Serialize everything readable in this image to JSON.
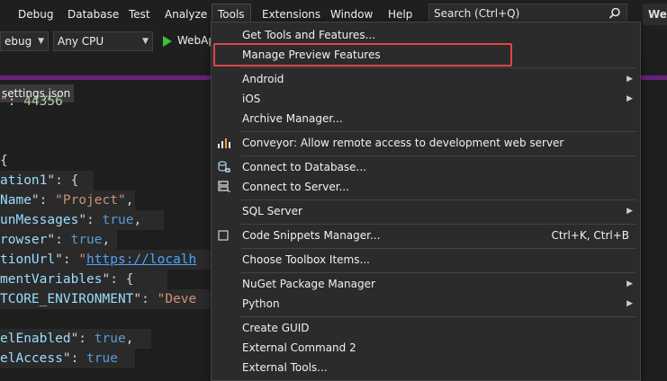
{
  "menubar": {
    "items": [
      "Debug",
      "Database",
      "Test",
      "Analyze",
      "Tools",
      "Extensions",
      "Window",
      "Help"
    ],
    "search_placeholder": "Search (Ctrl+Q)",
    "web_tab": "We"
  },
  "toolbar": {
    "config": "ebug",
    "platform": "Any CPU",
    "run_label": "WebAp"
  },
  "editor": {
    "file_tab": "settings.json",
    "lines": [
      {
        "parts": [
          [
            "s",
            "\""
          ],
          [
            "p",
            ": "
          ],
          [
            "n",
            "44356"
          ]
        ]
      },
      {
        "parts": []
      },
      {
        "parts": []
      },
      {
        "parts": [
          [
            "p",
            "{"
          ]
        ]
      },
      {
        "parts": [
          [
            "k",
            "ation1"
          ],
          [
            "p",
            "\": {"
          ]
        ]
      },
      {
        "parts": [
          [
            "k",
            "Name"
          ],
          [
            "p",
            "\": "
          ],
          [
            "s",
            "\"Project\""
          ],
          [
            "p",
            ","
          ]
        ]
      },
      {
        "parts": [
          [
            "k",
            "unMessages"
          ],
          [
            "p",
            "\": "
          ],
          [
            "b",
            "true"
          ],
          [
            "p",
            ","
          ]
        ]
      },
      {
        "parts": [
          [
            "k",
            "rowser"
          ],
          [
            "p",
            "\": "
          ],
          [
            "b",
            "true"
          ],
          [
            "p",
            ","
          ]
        ]
      },
      {
        "parts": [
          [
            "k",
            "tionUrl"
          ],
          [
            "p",
            "\": "
          ],
          [
            "s",
            "\""
          ],
          [
            "u",
            "https://localh"
          ]
        ]
      },
      {
        "parts": [
          [
            "k",
            "mentVariables"
          ],
          [
            "p",
            "\": {"
          ]
        ]
      },
      {
        "parts": [
          [
            "k",
            "TCORE_ENVIRONMENT"
          ],
          [
            "p",
            "\": "
          ],
          [
            "s",
            "\"Deve"
          ]
        ]
      },
      {
        "parts": []
      },
      {
        "parts": [
          [
            "k",
            "elEnabled"
          ],
          [
            "p",
            "\": "
          ],
          [
            "b",
            "true"
          ],
          [
            "p",
            ","
          ]
        ]
      },
      {
        "parts": [
          [
            "k",
            "elAccess"
          ],
          [
            "p",
            "\": "
          ],
          [
            "b",
            "true"
          ]
        ]
      }
    ]
  },
  "tools_menu": {
    "items": [
      {
        "label": "Get Tools and Features...",
        "icon": "",
        "shortcut": "",
        "submenu": false
      },
      {
        "label": "Manage Preview Features",
        "icon": "",
        "shortcut": "",
        "submenu": false
      },
      {
        "label": "Android",
        "icon": "",
        "shortcut": "",
        "submenu": true
      },
      {
        "label": "iOS",
        "icon": "",
        "shortcut": "",
        "submenu": true
      },
      {
        "label": "Archive Manager...",
        "icon": "",
        "shortcut": "",
        "submenu": false
      },
      {
        "label": "Conveyor: Allow remote access to development web server",
        "icon": "conveyor-icon",
        "shortcut": "",
        "submenu": false
      },
      {
        "label": "Connect to Database...",
        "icon": "database-connect-icon",
        "shortcut": "",
        "submenu": false
      },
      {
        "label": "Connect to Server...",
        "icon": "server-connect-icon",
        "shortcut": "",
        "submenu": false
      },
      {
        "label": "SQL Server",
        "icon": "",
        "shortcut": "",
        "submenu": true
      },
      {
        "label": "Code Snippets Manager...",
        "icon": "snippet-checkbox-icon",
        "shortcut": "Ctrl+K, Ctrl+B",
        "submenu": false
      },
      {
        "label": "Choose Toolbox Items...",
        "icon": "",
        "shortcut": "",
        "submenu": false
      },
      {
        "label": "NuGet Package Manager",
        "icon": "",
        "shortcut": "",
        "submenu": true
      },
      {
        "label": "Python",
        "icon": "",
        "shortcut": "",
        "submenu": true
      },
      {
        "label": "Create GUID",
        "icon": "",
        "shortcut": "",
        "submenu": false
      },
      {
        "label": "External Command 2",
        "icon": "",
        "shortcut": "",
        "submenu": false
      },
      {
        "label": "External Tools...",
        "icon": "",
        "shortcut": "",
        "submenu": false
      }
    ],
    "highlighted_item": "Manage Preview Features",
    "highlight_color": "#e04545"
  },
  "colors": {
    "accent_purple": "#68217a",
    "run_green": "#3fbf3f"
  }
}
